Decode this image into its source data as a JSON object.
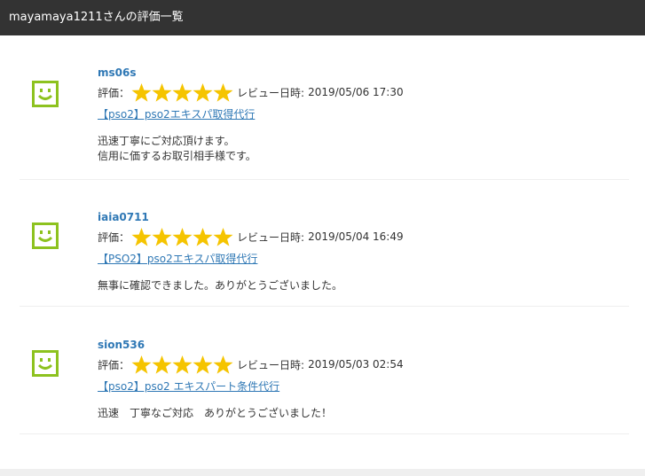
{
  "header": {
    "title": "mayamaya1211さんの評価一覧"
  },
  "reviews": [
    {
      "username": "ms06s",
      "rating_label": "評価：",
      "review_date_label": "レビュー日時:",
      "review_date": "2019/05/06 17:30",
      "service": "【pso2】pso2エキスパ取得代行",
      "comment_lines": [
        "迅速丁寧にご対応頂けます。",
        "信用に価するお取引相手様です。"
      ],
      "stars": 5
    },
    {
      "username": "iaia0711",
      "rating_label": "評価：",
      "review_date_label": "レビュー日時:",
      "review_date": "2019/05/04 16:49",
      "service": "【PSO2】pso2エキスパ取得代行",
      "comment_lines": [
        "無事に確認できました。ありがとうございました。"
      ],
      "stars": 5
    },
    {
      "username": "sion536",
      "rating_label": "評価：",
      "review_date_label": "レビュー日時:",
      "review_date": "2019/05/03 02:54",
      "service": "【pso2】pso2 エキスパート条件代行",
      "comment_lines": [
        "迅速　丁寧なご対応　ありがとうございました！"
      ],
      "stars": 5
    }
  ],
  "colors": {
    "header_bg": "#333333",
    "link": "#2f78b5",
    "star": "#f5c400",
    "avatar": "#8dc21f"
  },
  "icons": {
    "avatar": "smiley-face-icon",
    "star": "star-icon"
  }
}
